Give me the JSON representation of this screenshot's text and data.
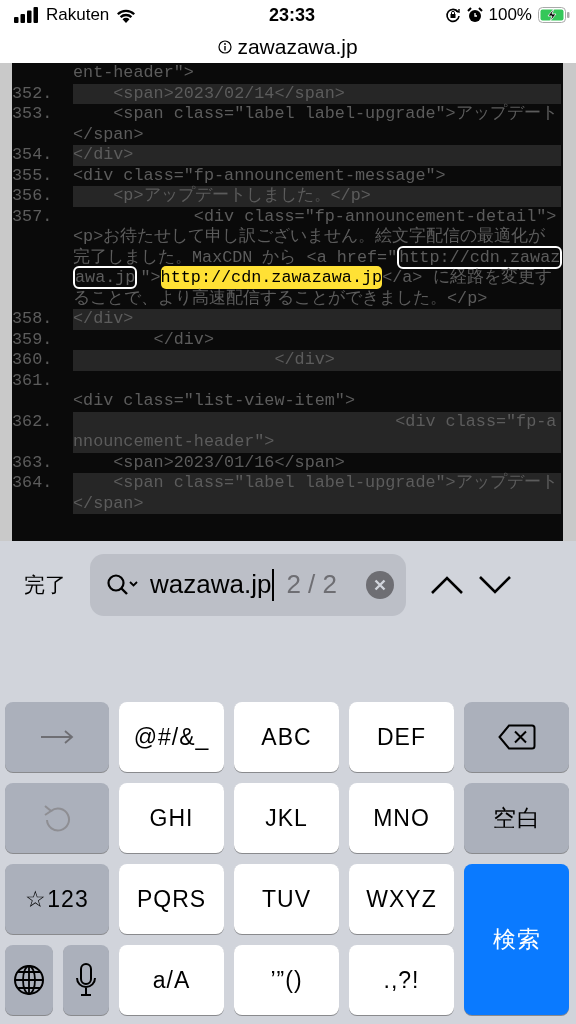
{
  "status_bar": {
    "carrier": "Rakuten",
    "time": "23:33",
    "battery": "100%"
  },
  "address_bar": {
    "domain": "zawazawa.jp"
  },
  "source": {
    "top_continuation": "ent-header\">",
    "lines": [
      {
        "number": "352.",
        "shaded": true,
        "text": "    <span>2023/02/14</span>"
      },
      {
        "number": "353.",
        "shaded": false,
        "text": "    <span class=\"label label-upgrade\">アップデート</span>"
      },
      {
        "number": "354.",
        "shaded": true,
        "text": "</div>"
      },
      {
        "number": "355.",
        "shaded": false,
        "text": "<div class=\"fp-announcement-message\">"
      },
      {
        "number": "356.",
        "shaded": true,
        "text": "    <p>アップデートしました。</p>"
      },
      {
        "number": "357.",
        "shaded": false,
        "segments": [
          {
            "kind": "plain",
            "text": "            <div class=\"fp-announcement-detail\"><p>お待たせして申し訳ございません。絵文字配信の最適化が完了しました。MaxCDN から <a href=\""
          },
          {
            "kind": "match",
            "text": "http://cdn.zawazawa.jp",
            "current": false
          },
          {
            "kind": "plain",
            "text": "\">"
          },
          {
            "kind": "match",
            "text": "http://cdn.zawazawa.jp",
            "current": true
          },
          {
            "kind": "plain",
            "text": "</a> に経路を変更することで、より高速配信することができました。</p>"
          }
        ]
      },
      {
        "number": "358.",
        "shaded": true,
        "text": "</div>"
      },
      {
        "number": "359.",
        "shaded": false,
        "text": "        </div>"
      },
      {
        "number": "360.",
        "shaded": true,
        "text": "                    </div>"
      },
      {
        "number": "361.",
        "shaded": false,
        "text": "                                                <div class=\"list-view-item\">"
      },
      {
        "number": "362.",
        "shaded": true,
        "text": "                                <div class=\"fp-announcement-header\">"
      },
      {
        "number": "363.",
        "shaded": false,
        "text": "    <span>2023/01/16</span>"
      },
      {
        "number": "364.",
        "shaded": true,
        "text": "    <span class=\"label label-upgrade\">アップデート</span>"
      }
    ]
  },
  "find_bar": {
    "done": "完了",
    "query": "wazawa.jp",
    "count": "2 / 2"
  },
  "keyboard": {
    "keys": [
      {
        "kind": "arrow"
      },
      {
        "kind": "text",
        "label": "@#/&_"
      },
      {
        "kind": "text",
        "label": "ABC"
      },
      {
        "kind": "text",
        "label": "DEF"
      },
      {
        "kind": "backspace"
      },
      {
        "kind": "undo"
      },
      {
        "kind": "text",
        "label": "GHI"
      },
      {
        "kind": "text",
        "label": "JKL"
      },
      {
        "kind": "text",
        "label": "MNO"
      },
      {
        "kind": "function",
        "label": "空白"
      },
      {
        "kind": "function",
        "label": "☆123"
      },
      {
        "kind": "text",
        "label": "PQRS"
      },
      {
        "kind": "text",
        "label": "TUV"
      },
      {
        "kind": "text",
        "label": "WXYZ"
      },
      {
        "kind": "primary",
        "label": "検索"
      },
      {
        "kind": "globe"
      },
      {
        "kind": "mic"
      },
      {
        "kind": "text",
        "label": "a/A"
      },
      {
        "kind": "text",
        "label": "’”()"
      },
      {
        "kind": "text",
        "label": ".,?!"
      }
    ]
  }
}
